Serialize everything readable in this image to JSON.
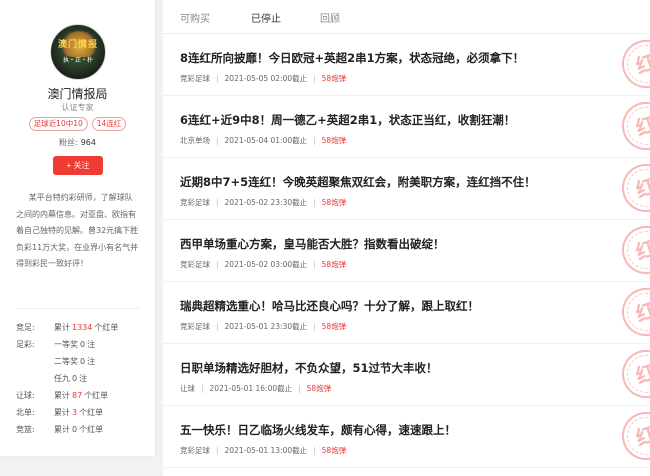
{
  "profile": {
    "avatar_text_main": "澳门情报",
    "avatar_text_sub": "执・正・朴",
    "name": "澳门情报局",
    "verify": "认证专家",
    "tags": [
      "足球近10中10",
      "14连红"
    ],
    "fans_label": "粉丝:",
    "fans_count": "964",
    "follow_label": "+ 关注",
    "bio": "某平台特约彩研师，了解球队之间的内幕信息。对亚盘、欧指有着自己独特的见解。曾32元擒下胜负彩11万大奖，在业界小有名气并得到彩民一致好评！",
    "stats": [
      {
        "label": "竞足:",
        "prefix": "累计",
        "value": "1334",
        "suffix": "个红单",
        "highlight": true
      },
      {
        "label": "足彩:",
        "prefix": "一等奖",
        "value": "0",
        "suffix": "注",
        "highlight": false
      },
      {
        "label": "",
        "prefix": "二等奖",
        "value": "0",
        "suffix": "注",
        "highlight": false
      },
      {
        "label": "",
        "prefix": "任九",
        "value": "0",
        "suffix": "注",
        "highlight": false
      },
      {
        "label": "让球:",
        "prefix": "累计",
        "value": "87",
        "suffix": "个红单",
        "highlight": true
      },
      {
        "label": "北单:",
        "prefix": "累计",
        "value": "3",
        "suffix": "个红单",
        "highlight": true
      },
      {
        "label": "竞篮:",
        "prefix": "累计",
        "value": "0",
        "suffix": "个红单",
        "highlight": false
      }
    ]
  },
  "tabs": [
    "可购买",
    "已停止",
    "回顾"
  ],
  "active_tab": 1,
  "items": [
    {
      "title": "8连红所向披靡！今日欧冠+英超2串1方案，状态冠绝，必须拿下！",
      "category": "竞彩足球",
      "time": "2021-05-05 02:00截止",
      "price": "58炮弹"
    },
    {
      "title": "6连红+近9中8！周一德乙+英超2串1，状态正当红，收割狂潮！",
      "category": "北京单场",
      "time": "2021-05-04 01:00截止",
      "price": "58炮弹"
    },
    {
      "title": "近期8中7+5连红！今晚英超聚焦双红会，附美职方案，连红挡不住！",
      "category": "竞彩足球",
      "time": "2021-05-02 23:30截止",
      "price": "58炮弹"
    },
    {
      "title": "西甲单场重心方案，皇马能否大胜？指数看出破绽！",
      "category": "竞彩足球",
      "time": "2021-05-02 03:00截止",
      "price": "58炮弹"
    },
    {
      "title": "瑞典超精选重心！哈马比还良心吗？十分了解，跟上取红！",
      "category": "竞彩足球",
      "time": "2021-05-01 23:30截止",
      "price": "58炮弹"
    },
    {
      "title": "日职单场精选好胆材，不负众望，51过节大丰收！",
      "category": "让球",
      "time": "2021-05-01 16:00截止",
      "price": "58炮弹"
    },
    {
      "title": "五一快乐！日乙临场火线发车，颇有心得，速速跟上！",
      "category": "竞彩足球",
      "time": "2021-05-01 13:00截止",
      "price": "58炮弹"
    }
  ],
  "stamp_text": "红"
}
